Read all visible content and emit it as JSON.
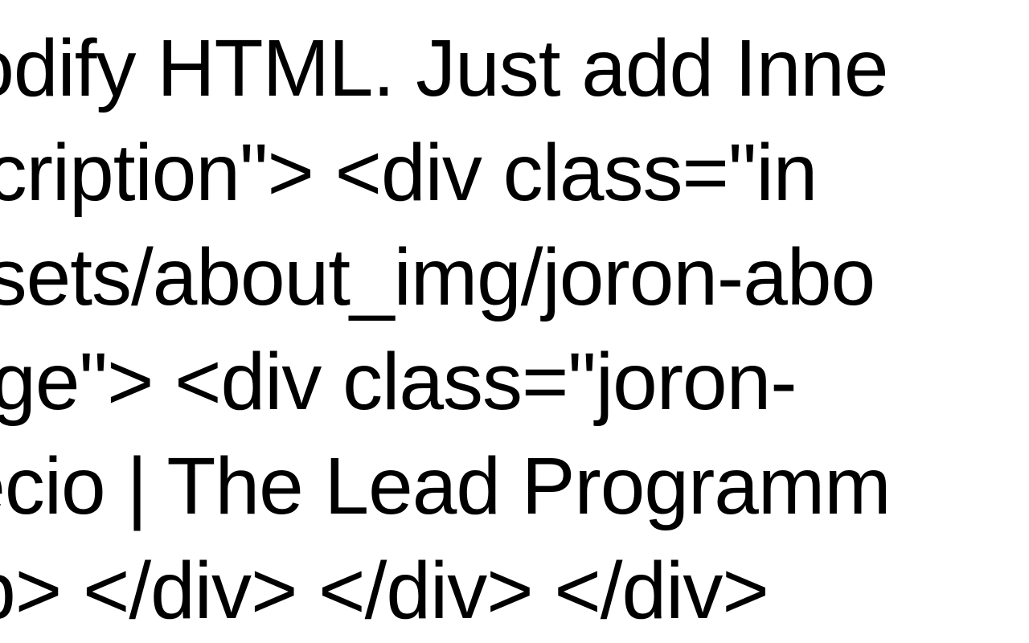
{
  "content": {
    "line1": " Modify HTML. Just add Inne",
    "line2": "escription\">   <div class=\"in",
    "line3": "assets/about_img/joron-abo",
    "line4": "nage\">     <div class=\"joron-",
    "line5": "Recio | The Lead Programm",
    "line6": "</p>     </div>   </div> </div>"
  }
}
